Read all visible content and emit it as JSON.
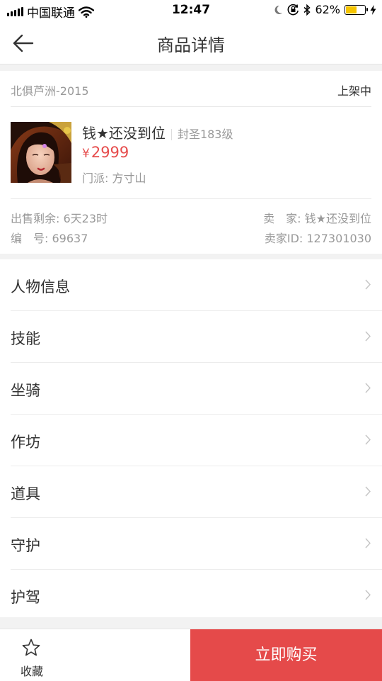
{
  "status_bar": {
    "carrier": "中国联通",
    "time": "12:47",
    "battery_percent": "62%",
    "battery_level": 0.62,
    "icons": [
      "signal-icon",
      "wifi-icon",
      "moon-icon",
      "rotation-lock-icon",
      "bluetooth-icon",
      "battery-icon",
      "charging-icon"
    ]
  },
  "header": {
    "title": "商品详情",
    "back_icon": "back-arrow-icon"
  },
  "product": {
    "server": "北俱芦洲-2015",
    "state": "上架中",
    "role_name": "钱★还没到位",
    "level": "封圣183级",
    "currency": "¥",
    "price": "2999",
    "sect_label": "门派: 方寸山",
    "remaining": "出售剩余: 6天23时",
    "seller": "卖　家: 钱★还没到位",
    "number": "编　号: 69637",
    "seller_id": "卖家ID: 127301030",
    "accent_color": "#e64c4c"
  },
  "menu": {
    "items": [
      {
        "label": "人物信息"
      },
      {
        "label": "技能"
      },
      {
        "label": "坐骑"
      },
      {
        "label": "作坊"
      },
      {
        "label": "道具"
      },
      {
        "label": "守护"
      },
      {
        "label": "护驾"
      }
    ]
  },
  "bottom_bar": {
    "favorite_label": "收藏",
    "favorite_icon": "star-icon",
    "buy_label": "立即购买",
    "buy_color": "#e54a4a"
  }
}
